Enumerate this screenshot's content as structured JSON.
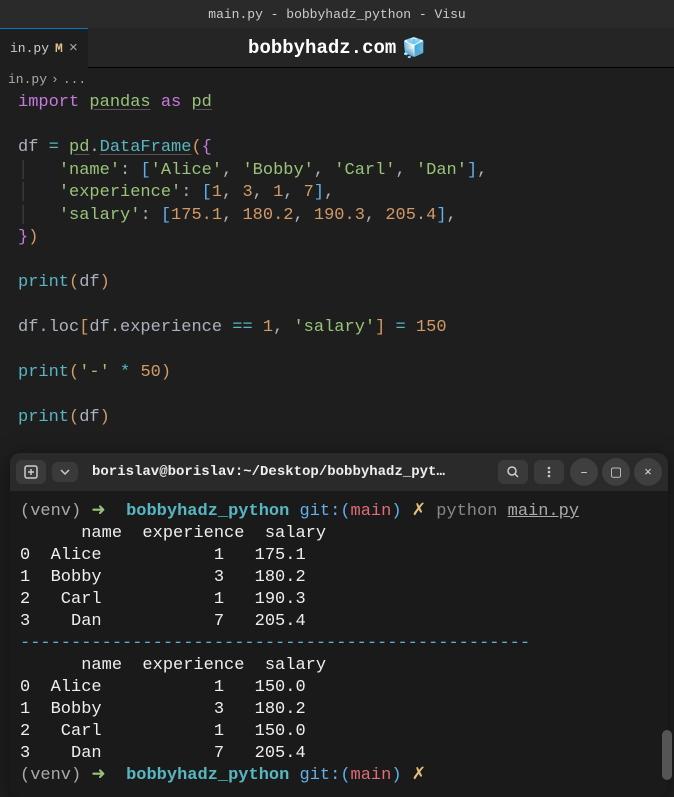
{
  "titlebar": "main.py - bobbyhadz_python - Visu",
  "tab": {
    "name": "in.py",
    "modified": "M",
    "site": "bobbyhadz.com"
  },
  "breadcrumb": {
    "file": "in.py",
    "sep": "›",
    "rest": "..."
  },
  "code": {
    "l1": {
      "kw": "import",
      "mod": "pandas",
      "as": "as",
      "alias": "pd"
    },
    "l3": {
      "v": "df",
      "eq": "=",
      "p": "pd",
      "attr": "DataFrame"
    },
    "l4": {
      "key": "'name'",
      "vals": [
        "'Alice'",
        "'Bobby'",
        "'Carl'",
        "'Dan'"
      ]
    },
    "l5": {
      "key": "'experience'",
      "vals": [
        "1",
        "3",
        "1",
        "7"
      ]
    },
    "l6": {
      "key": "'salary'",
      "vals": [
        "175.1",
        "180.2",
        "190.3",
        "205.4"
      ]
    },
    "l9": {
      "fn": "print",
      "arg": "df"
    },
    "l11": {
      "a": "df",
      "b": "loc",
      "c": "df",
      "d": "experience",
      "op": "==",
      "n": "1",
      "s": "'salary'",
      "eq": "=",
      "v": "150"
    },
    "l13": {
      "fn": "print",
      "s": "'-'",
      "op": "*",
      "n": "50"
    },
    "l15": {
      "fn": "print",
      "arg": "df"
    }
  },
  "terminal": {
    "title": "borislav@borislav:~/Desktop/bobbyhadz_pyt…",
    "prompt": {
      "venv": "(venv)",
      "arrow": "➜",
      "dir": "bobbyhadz_python",
      "git": "git:(",
      "branch": "main",
      "close": ")",
      "x": "✗"
    },
    "cmd": {
      "bin": "python",
      "arg": "main.py"
    },
    "header": "      name  experience  salary",
    "rows1": [
      "0  Alice           1   175.1",
      "1  Bobby           3   180.2",
      "2   Carl           1   190.3",
      "3    Dan           7   205.4"
    ],
    "sep": "--------------------------------------------------",
    "rows2": [
      "0  Alice           1   150.0",
      "1  Bobby           3   180.2",
      "2   Carl           1   150.0",
      "3    Dan           7   205.4"
    ]
  },
  "icons": {
    "cube": "🧊"
  }
}
